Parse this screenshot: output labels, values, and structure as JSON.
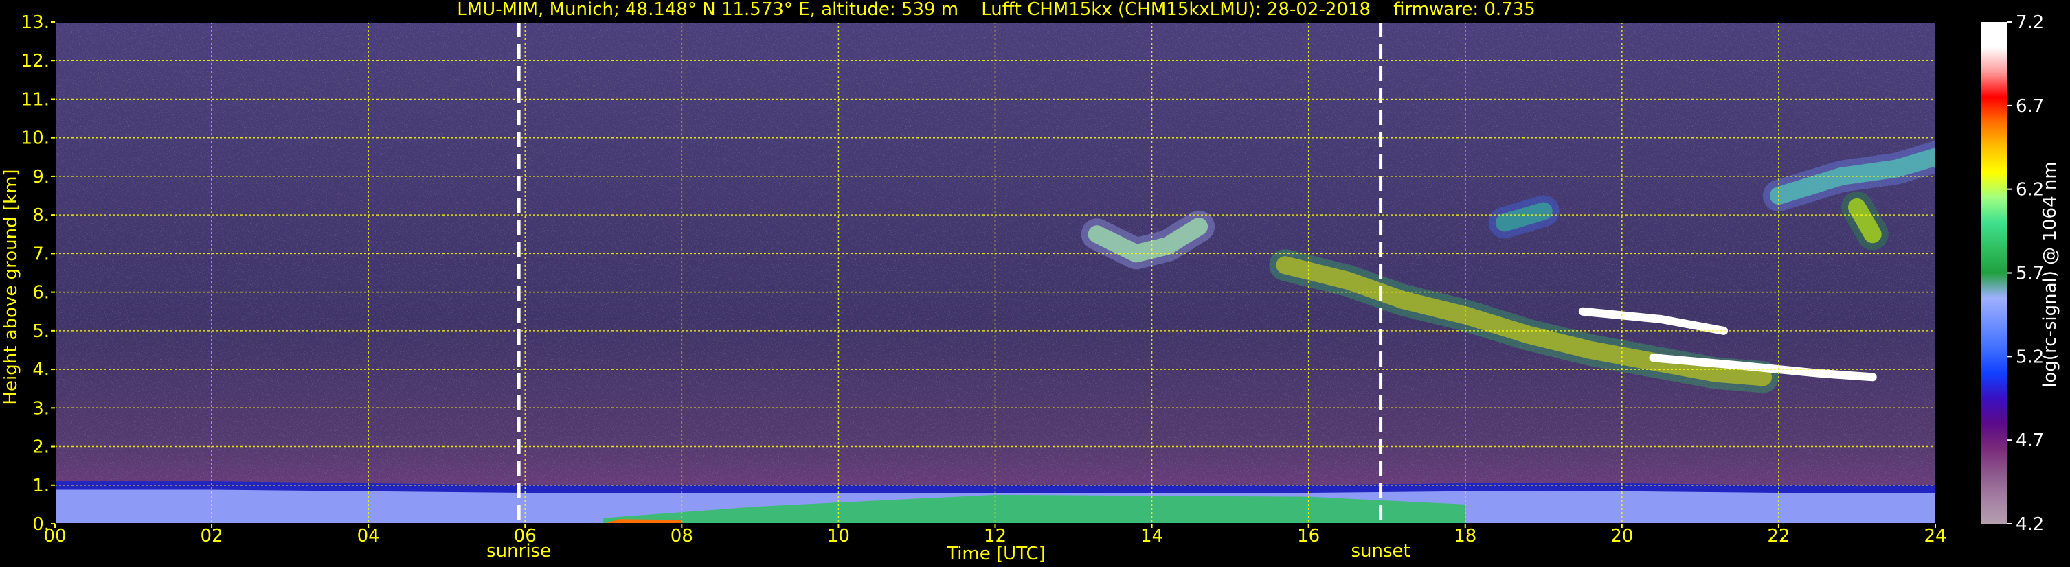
{
  "chart_data": {
    "type": "heatmap",
    "title": "LMU-MIM, Munich; 48.148° N 11.573° E, altitude: 539 m    Lufft CHM15kx (CHM15kxLMU): 28-02-2018    firmware: 0.735",
    "xlabel": "Time [UTC]",
    "ylabel": "Height above ground [km]",
    "xlim": [
      0,
      24
    ],
    "ylim": [
      0,
      13
    ],
    "x_ticks": [
      0,
      2,
      4,
      6,
      8,
      10,
      12,
      14,
      16,
      18,
      20,
      22,
      24
    ],
    "x_tick_labels": [
      "00",
      "02",
      "04",
      "06",
      "08",
      "10",
      "12",
      "14",
      "16",
      "18",
      "20",
      "22",
      "24"
    ],
    "y_ticks": [
      0,
      1,
      2,
      3,
      4,
      5,
      6,
      7,
      8,
      9,
      10,
      11,
      12,
      13
    ],
    "y_tick_labels": [
      "0.",
      "1.",
      "2.",
      "3.",
      "4.",
      "5.",
      "6.",
      "7.",
      "8.",
      "9.",
      "10.",
      "11.",
      "12.",
      "13."
    ],
    "grid": true,
    "colorbar": {
      "label": "log(rc-signal) @ 1064 nm",
      "range": [
        4.2,
        7.2
      ],
      "ticks": [
        4.2,
        4.7,
        5.2,
        5.7,
        6.2,
        6.7,
        7.2
      ],
      "tick_labels": [
        "4.2",
        "4.7",
        "5.2",
        "5.7",
        "6.2",
        "6.7",
        "7.2"
      ],
      "stops": [
        "#b59fb0",
        "#a57fa3",
        "#8c5a8c",
        "#7a2a7a",
        "#5a0a8a",
        "#3a10c0",
        "#1040ff",
        "#4070ff",
        "#7090ff",
        "#a0b0ff",
        "#20a040",
        "#30c060",
        "#40e090",
        "#a0ff80",
        "#ffff00",
        "#ffc000",
        "#ff7000",
        "#ff0000",
        "#ff9a9a",
        "#ffffff",
        "#ffffff"
      ]
    },
    "markers": [
      {
        "x": 5.92,
        "label": "sunrise"
      },
      {
        "x": 16.92,
        "label": "sunset"
      }
    ],
    "boundary_layer": {
      "top": [
        [
          0,
          1.1
        ],
        [
          2,
          1.1
        ],
        [
          4,
          1.05
        ],
        [
          6,
          1.0
        ],
        [
          8,
          1.0
        ],
        [
          10,
          1.0
        ],
        [
          12,
          1.0
        ],
        [
          14,
          1.0
        ],
        [
          16,
          1.0
        ],
        [
          18,
          1.05
        ],
        [
          20,
          1.05
        ],
        [
          22,
          1.0
        ],
        [
          24,
          1.0
        ]
      ],
      "signal_level": 5.3
    },
    "cloud_layers": [
      {
        "name": "cirrus-14h",
        "points": [
          [
            13.3,
            7.5
          ],
          [
            13.8,
            7.0
          ],
          [
            14.2,
            7.2
          ],
          [
            14.6,
            7.7
          ]
        ],
        "signal_level": 6.2
      },
      {
        "name": "cirrus-16-19h",
        "points": [
          [
            15.7,
            6.7
          ],
          [
            16.5,
            6.3
          ],
          [
            17.2,
            5.8
          ],
          [
            18.0,
            5.4
          ],
          [
            18.8,
            4.9
          ],
          [
            19.6,
            4.5
          ],
          [
            20.4,
            4.2
          ],
          [
            21.2,
            3.9
          ],
          [
            21.8,
            3.8
          ]
        ],
        "signal_level": 6.4
      },
      {
        "name": "upper-cirrus",
        "points": [
          [
            18.5,
            7.8
          ],
          [
            19.0,
            8.1
          ]
        ],
        "signal_level": 5.9
      },
      {
        "name": "white-band-1",
        "points": [
          [
            19.5,
            5.5
          ],
          [
            20.5,
            5.3
          ],
          [
            21.3,
            5.0
          ]
        ],
        "signal_level": 7.2
      },
      {
        "name": "white-band-2",
        "points": [
          [
            20.4,
            4.3
          ],
          [
            21.5,
            4.1
          ],
          [
            22.5,
            3.9
          ],
          [
            23.2,
            3.8
          ]
        ],
        "signal_level": 7.2
      },
      {
        "name": "cirrus-22-24h",
        "points": [
          [
            22.0,
            8.5
          ],
          [
            22.8,
            9.0
          ],
          [
            23.5,
            9.2
          ],
          [
            24,
            9.5
          ]
        ],
        "signal_level": 6.0
      },
      {
        "name": "cirrus-23h",
        "points": [
          [
            23.0,
            8.2
          ],
          [
            23.2,
            7.5
          ]
        ],
        "signal_level": 6.3
      }
    ]
  }
}
